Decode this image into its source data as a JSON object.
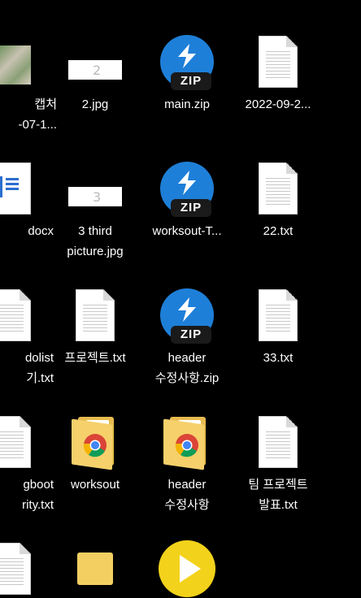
{
  "desktop": {
    "items": [
      {
        "label": "캡처\n-07-1...",
        "icon": "image-capture-icon"
      },
      {
        "label": "2.jpg",
        "icon": "image-thumbnail-icon"
      },
      {
        "label": "main.zip",
        "icon": "zip-archive-icon"
      },
      {
        "label": "2022-09-2...",
        "icon": "text-document-icon"
      },
      {
        "label": "docx",
        "icon": "word-document-icon"
      },
      {
        "label": "3 third\npicture.jpg",
        "icon": "image-thumbnail-icon"
      },
      {
        "label": "worksout-T...",
        "icon": "zip-archive-icon"
      },
      {
        "label": "22.txt",
        "icon": "text-document-icon"
      },
      {
        "label": "dolist\n기.txt",
        "icon": "text-document-icon"
      },
      {
        "label": "프로젝트.txt",
        "icon": "text-document-icon"
      },
      {
        "label": "header\n수정사항.zip",
        "icon": "zip-archive-icon"
      },
      {
        "label": "33.txt",
        "icon": "text-document-icon"
      },
      {
        "label": "gboot\nrity.txt",
        "icon": "text-document-icon"
      },
      {
        "label": "worksout",
        "icon": "chrome-folder-icon"
      },
      {
        "label": "header\n수정사항",
        "icon": "chrome-folder-icon"
      },
      {
        "label": "팀 프로젝트\n발표.txt",
        "icon": "text-document-icon"
      },
      {
        "label": "",
        "icon": "text-document-icon"
      },
      {
        "label": "",
        "icon": "folder-icon"
      },
      {
        "label": "",
        "icon": "media-player-icon"
      }
    ],
    "zip_tag": "ZIP",
    "thumb_2_glyph": "2",
    "thumb_3_glyph": "3"
  }
}
